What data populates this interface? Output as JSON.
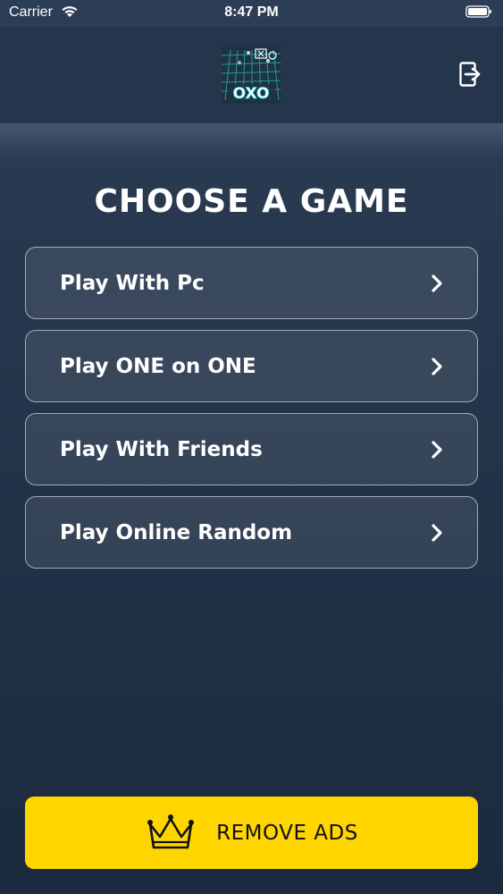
{
  "status_bar": {
    "carrier": "Carrier",
    "time": "8:47 PM"
  },
  "header": {
    "logo_text": "OXO",
    "logo_icon": "oxo-grid-logo",
    "logout_icon": "logout-icon"
  },
  "main": {
    "title": "CHOOSE A GAME",
    "menu": [
      {
        "label": "Play With Pc"
      },
      {
        "label": "Play ONE on ONE"
      },
      {
        "label": "Play With Friends"
      },
      {
        "label": "Play Online Random"
      }
    ]
  },
  "footer": {
    "remove_ads_label": "REMOVE ADS",
    "remove_ads_color": "#ffd500",
    "crown_icon": "crown-icon"
  }
}
